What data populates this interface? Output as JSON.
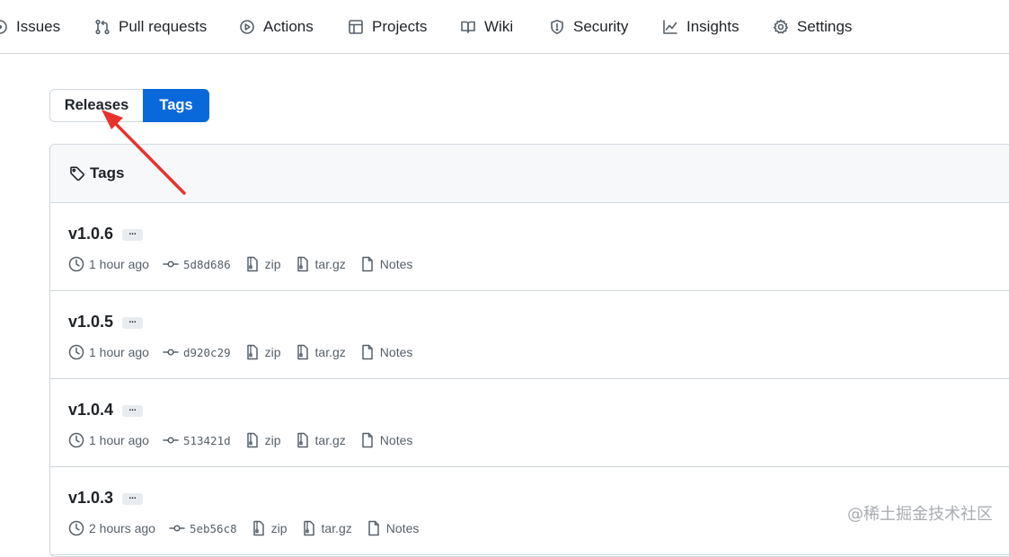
{
  "nav": {
    "items": [
      {
        "label": "Issues",
        "icon": "issue-icon"
      },
      {
        "label": "Pull requests",
        "icon": "pull-request-icon"
      },
      {
        "label": "Actions",
        "icon": "play-icon"
      },
      {
        "label": "Projects",
        "icon": "table-icon"
      },
      {
        "label": "Wiki",
        "icon": "book-icon"
      },
      {
        "label": "Security",
        "icon": "shield-icon"
      },
      {
        "label": "Insights",
        "icon": "graph-icon"
      },
      {
        "label": "Settings",
        "icon": "gear-icon"
      }
    ]
  },
  "toggle": {
    "releases_label": "Releases",
    "tags_label": "Tags",
    "active": "Tags"
  },
  "box": {
    "title": "Tags"
  },
  "more_label": "...",
  "tags": [
    {
      "name": "v1.0.6",
      "time": "1 hour ago",
      "sha": "5d8d686",
      "zip": "zip",
      "tar": "tar.gz",
      "notes": "Notes"
    },
    {
      "name": "v1.0.5",
      "time": "1 hour ago",
      "sha": "d920c29",
      "zip": "zip",
      "tar": "tar.gz",
      "notes": "Notes"
    },
    {
      "name": "v1.0.4",
      "time": "1 hour ago",
      "sha": "513421d",
      "zip": "zip",
      "tar": "tar.gz",
      "notes": "Notes"
    },
    {
      "name": "v1.0.3",
      "time": "2 hours ago",
      "sha": "5eb56c8",
      "zip": "zip",
      "tar": "tar.gz",
      "notes": "Notes"
    }
  ],
  "watermark": "@稀土掘金技术社区",
  "colors": {
    "accent": "#0969da",
    "annotation_arrow": "#e8322d",
    "border": "#d0d7de",
    "muted": "#57606a"
  }
}
